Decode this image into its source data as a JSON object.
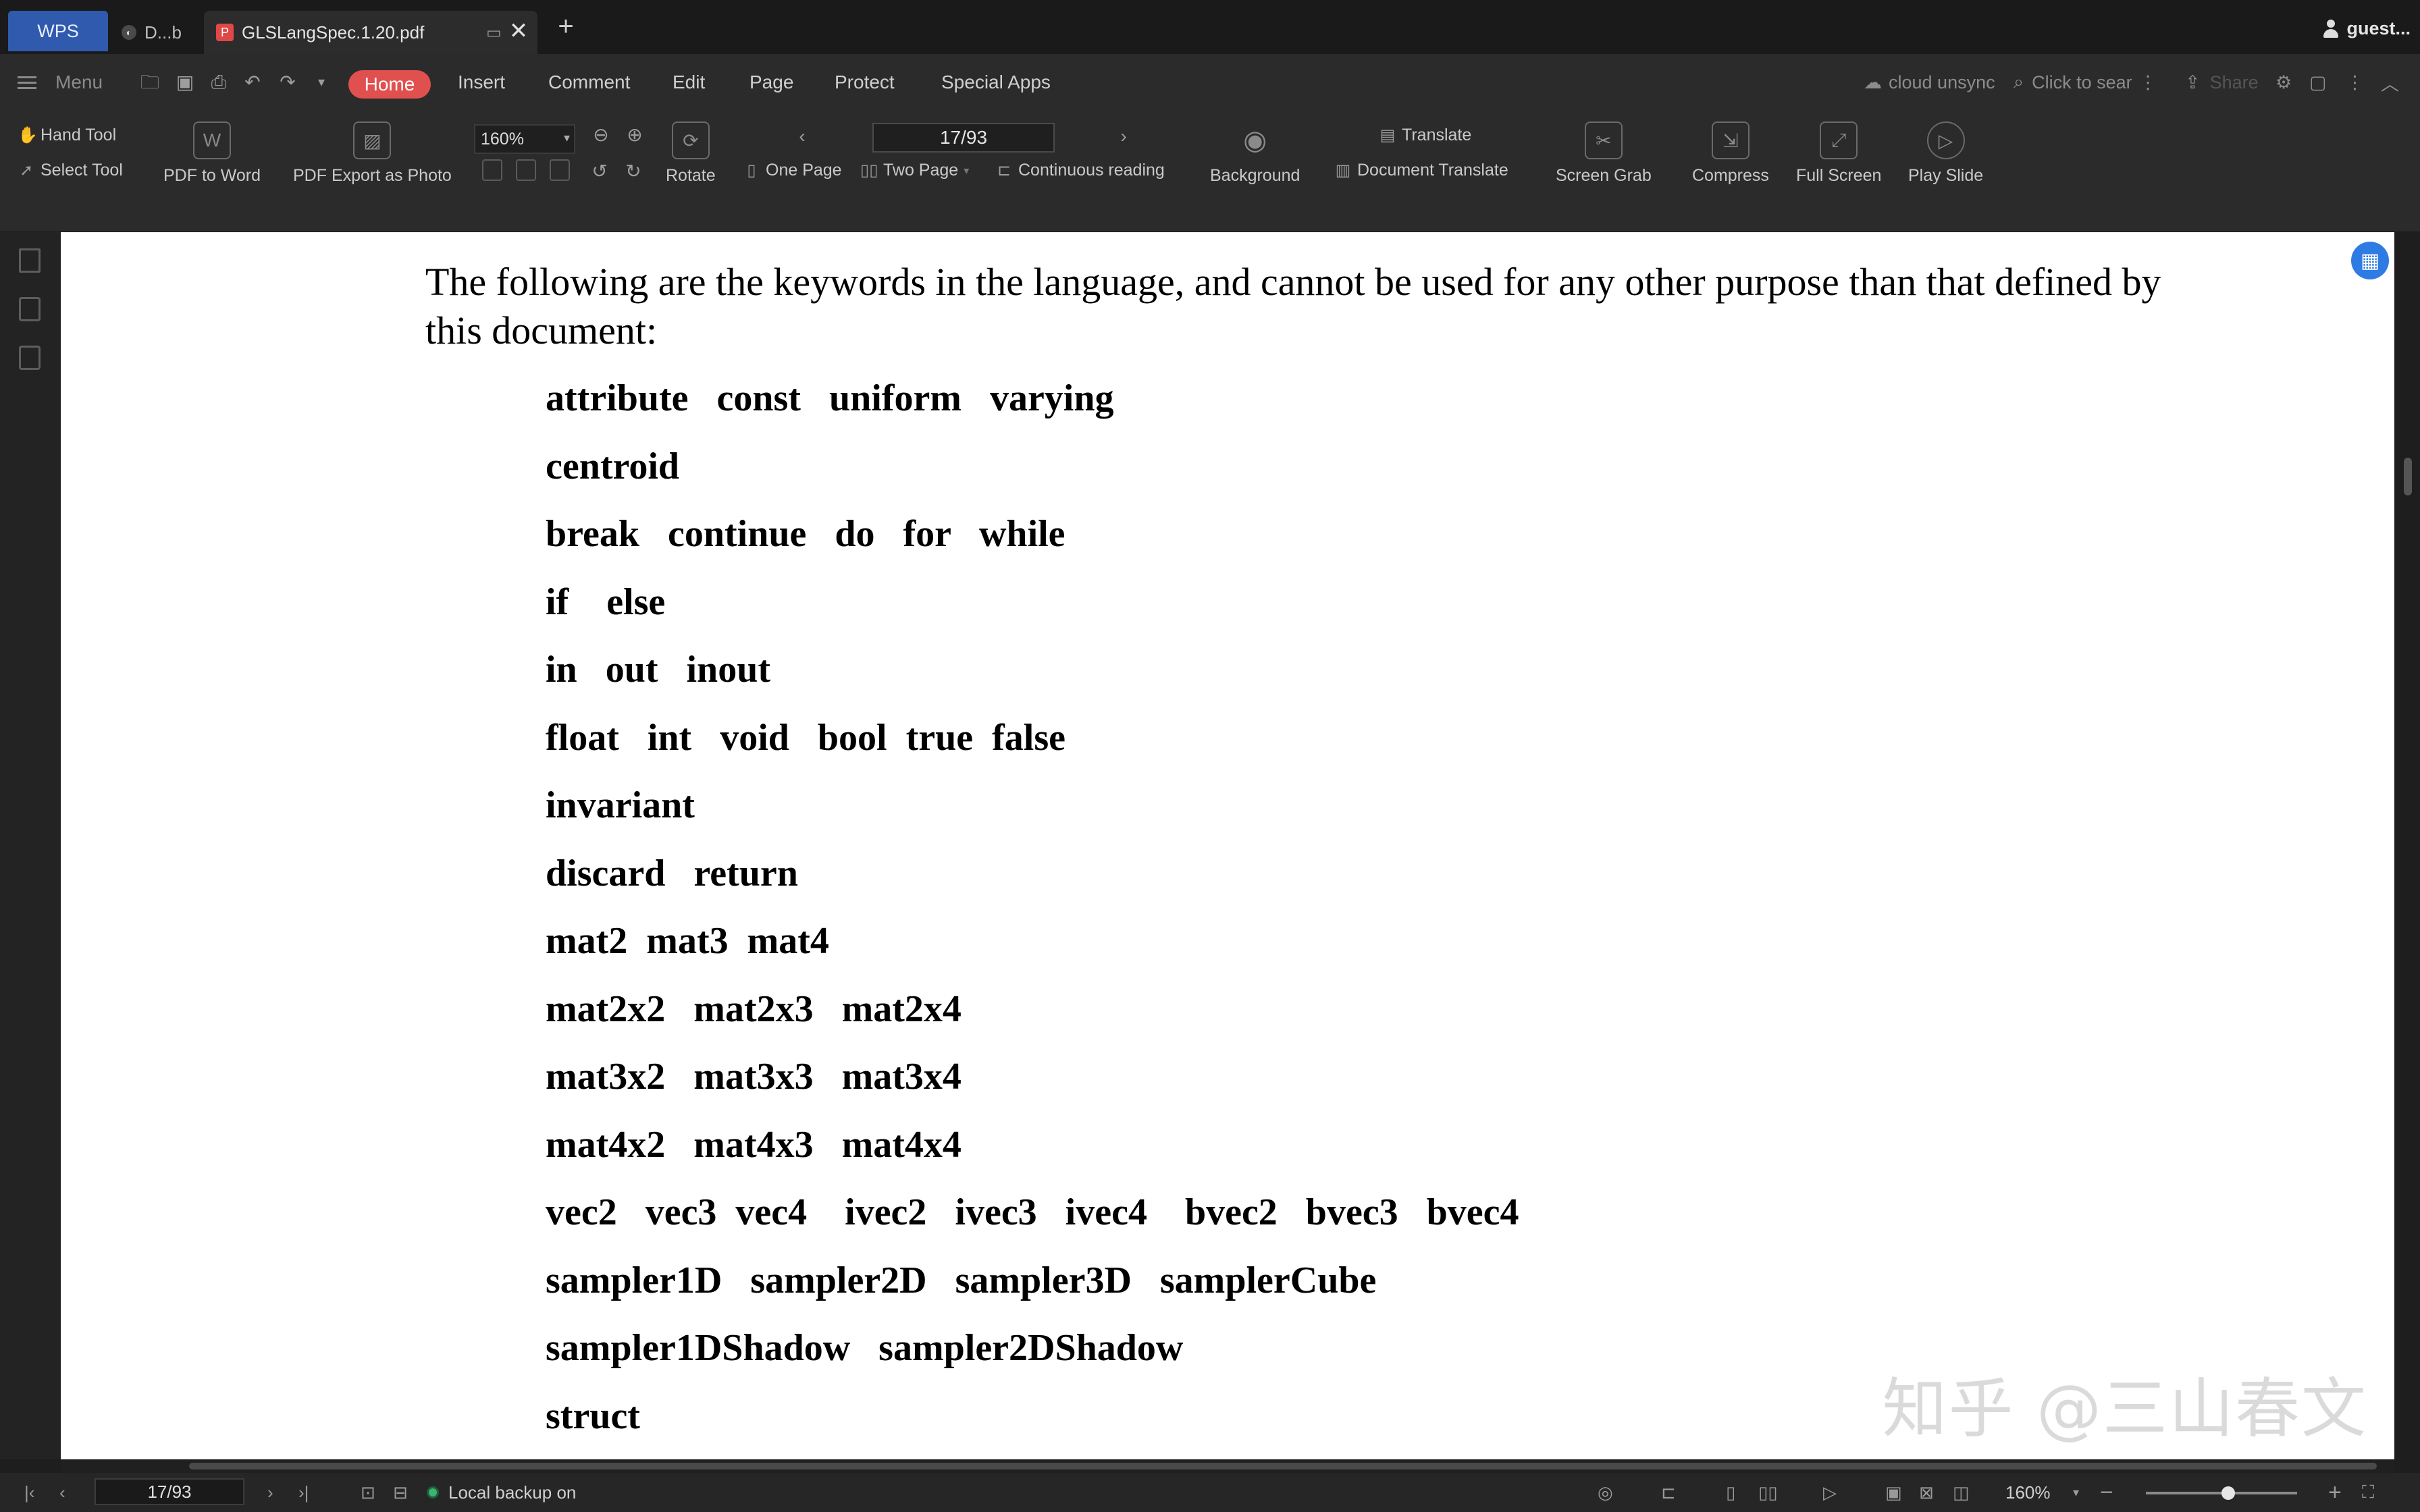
{
  "tabs": {
    "wps_label": "WPS",
    "doc1_label": "D...b",
    "doc2_label": "GLSLangSpec.1.20.pdf",
    "new_tab_symbol": "+",
    "close_symbol": "✕",
    "user_label": "guest..."
  },
  "menubar": {
    "menu_label": "Menu",
    "items": [
      "Home",
      "Insert",
      "Comment",
      "Edit",
      "Page",
      "Protect",
      "Special Apps"
    ],
    "cloud_status": "cloud unsync",
    "search_placeholder": "Click to sear",
    "share_label": "Share"
  },
  "ribbon": {
    "hand_tool": "Hand Tool",
    "select_tool": "Select Tool",
    "pdf_to_word": "PDF to Word",
    "pdf_export_photo": "PDF Export as Photo",
    "zoom_value": "160%",
    "page_value": "17/93",
    "rotate": "Rotate",
    "one_page": "One Page",
    "two_page": "Two Page",
    "continuous_reading": "Continuous reading",
    "background": "Background",
    "translate": "Translate",
    "document_translate": "Document Translate",
    "screen_grab": "Screen Grab",
    "compress": "Compress",
    "full_screen": "Full Screen",
    "play_slide": "Play Slide"
  },
  "document": {
    "intro": "The following are the keywords in the language, and cannot be used for any other purpose than that defined by this document:",
    "keyword_lines": [
      "attribute   const   uniform   varying",
      "centroid",
      "break   continue   do   for   while",
      "if    else",
      "in   out   inout",
      "float   int   void   bool  true  false",
      "invariant",
      "discard   return",
      "mat2  mat3  mat4",
      "mat2x2   mat2x3   mat2x4",
      "mat3x2   mat3x3   mat3x4",
      "mat4x2   mat4x3   mat4x4",
      "vec2   vec3  vec4    ivec2   ivec3   ivec4    bvec2   bvec3   bvec4",
      "sampler1D   sampler2D   sampler3D   samplerCube",
      "sampler1DShadow   sampler2DShadow",
      "struct"
    ],
    "watermark": "知乎 @三山春文"
  },
  "statusbar": {
    "page_value": "17/93",
    "backup_label": "Local backup on",
    "zoom_value": "160%"
  },
  "colors": {
    "accent_home": "#e0504f",
    "wps_blue": "#2f5aad",
    "page_bg": "#ffffff",
    "chrome_bg": "#2b2b2b"
  }
}
